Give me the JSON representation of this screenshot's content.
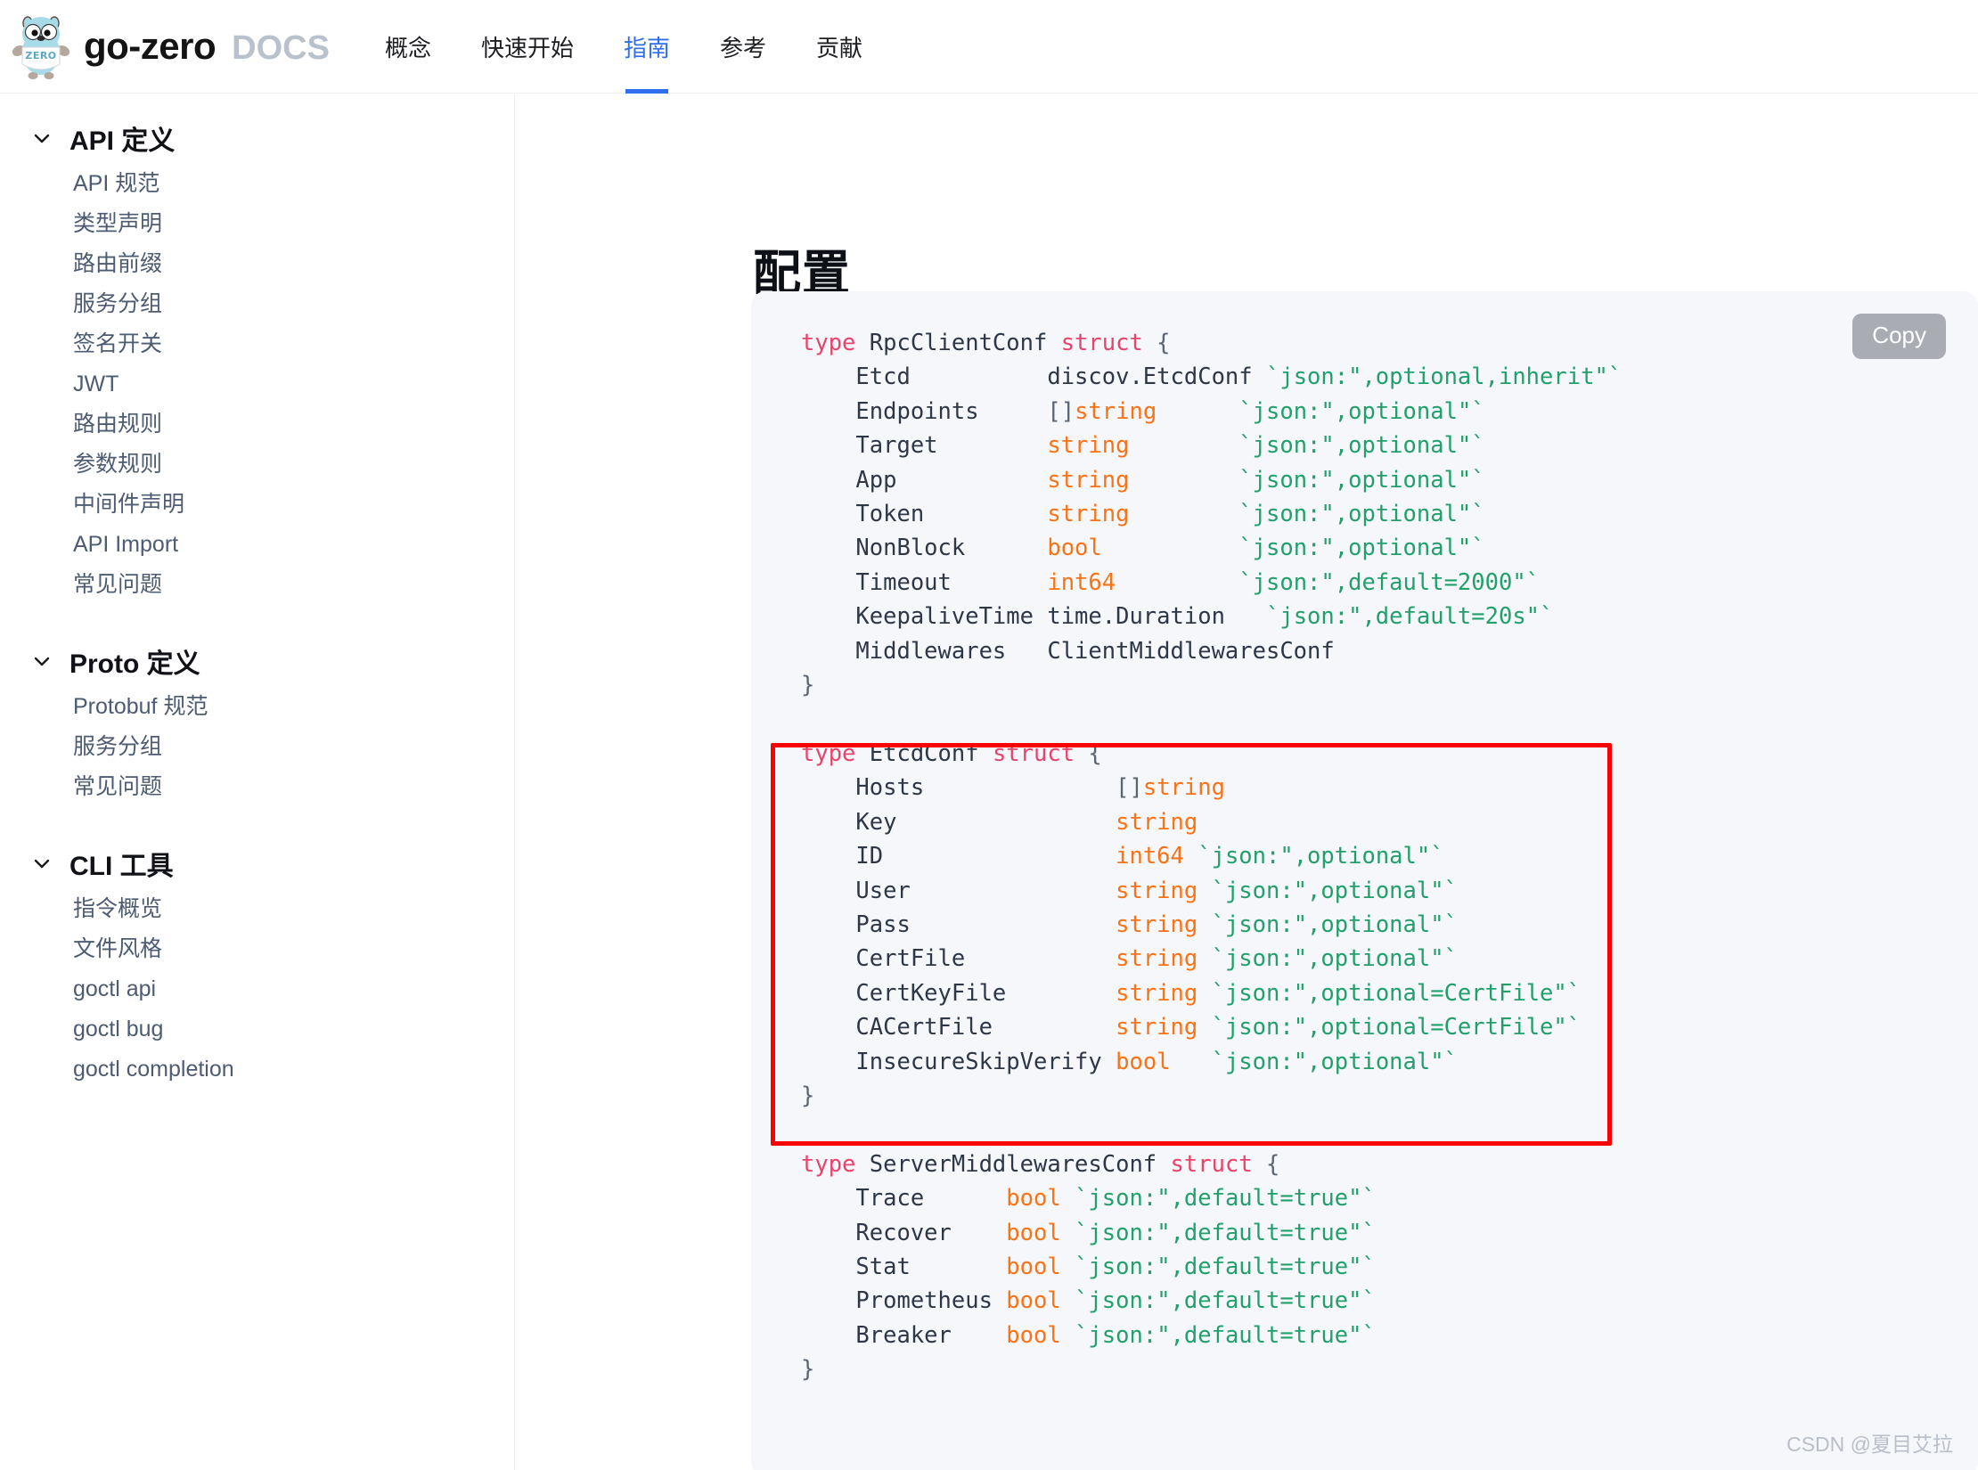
{
  "header": {
    "logo_icon": "go-gopher-zero-logo",
    "brand_name": "go-zero",
    "brand_docs": "DOCS",
    "nav": [
      {
        "label": "概念",
        "active": false
      },
      {
        "label": "快速开始",
        "active": false
      },
      {
        "label": "指南",
        "active": true
      },
      {
        "label": "参考",
        "active": false
      },
      {
        "label": "贡献",
        "active": false
      }
    ],
    "active_color": "#2f6fed"
  },
  "sidebar": {
    "sections": [
      {
        "title": "API 定义",
        "chevron_icon": "chevron-down-icon",
        "items": [
          "API 规范",
          "类型声明",
          "路由前缀",
          "服务分组",
          "签名开关",
          "JWT",
          "路由规则",
          "参数规则",
          "中间件声明",
          "API Import",
          "常见问题"
        ]
      },
      {
        "title": "Proto 定义",
        "chevron_icon": "chevron-down-icon",
        "items": [
          "Protobuf 规范",
          "服务分组",
          "常见问题"
        ]
      },
      {
        "title": "CLI 工具",
        "chevron_icon": "chevron-down-icon",
        "items": [
          "指令概览",
          "文件风格",
          "goctl api",
          "goctl bug",
          "goctl completion"
        ]
      }
    ]
  },
  "main": {
    "page_title": "配置",
    "copy_button": "Copy",
    "highlight_border_color": "#fa0000",
    "code_background": "#f6f7fb",
    "code_lines": [
      [
        {
          "t": "type ",
          "c": "key"
        },
        {
          "t": "RpcClientConf ",
          "c": "ident"
        },
        {
          "t": "struct",
          "c": "key"
        },
        {
          "t": " {",
          "c": "punc"
        }
      ],
      [
        {
          "t": "    Etcd          discov.EtcdConf ",
          "c": "ident"
        },
        {
          "t": "`json:\",optional,inherit\"`",
          "c": "tag"
        }
      ],
      [
        {
          "t": "    Endpoints     ",
          "c": "ident"
        },
        {
          "t": "[]",
          "c": "punc"
        },
        {
          "t": "string",
          "c": "type"
        },
        {
          "t": "      ",
          "c": "ident"
        },
        {
          "t": "`json:\",optional\"`",
          "c": "tag"
        }
      ],
      [
        {
          "t": "    Target        ",
          "c": "ident"
        },
        {
          "t": "string",
          "c": "type"
        },
        {
          "t": "        ",
          "c": "ident"
        },
        {
          "t": "`json:\",optional\"`",
          "c": "tag"
        }
      ],
      [
        {
          "t": "    App           ",
          "c": "ident"
        },
        {
          "t": "string",
          "c": "type"
        },
        {
          "t": "        ",
          "c": "ident"
        },
        {
          "t": "`json:\",optional\"`",
          "c": "tag"
        }
      ],
      [
        {
          "t": "    Token         ",
          "c": "ident"
        },
        {
          "t": "string",
          "c": "type"
        },
        {
          "t": "        ",
          "c": "ident"
        },
        {
          "t": "`json:\",optional\"`",
          "c": "tag"
        }
      ],
      [
        {
          "t": "    NonBlock      ",
          "c": "ident"
        },
        {
          "t": "bool",
          "c": "type"
        },
        {
          "t": "          ",
          "c": "ident"
        },
        {
          "t": "`json:\",optional\"`",
          "c": "tag"
        }
      ],
      [
        {
          "t": "    Timeout       ",
          "c": "ident"
        },
        {
          "t": "int64",
          "c": "type"
        },
        {
          "t": "         ",
          "c": "ident"
        },
        {
          "t": "`json:\",default=2000\"`",
          "c": "tag"
        }
      ],
      [
        {
          "t": "    KeepaliveTime time.Duration   ",
          "c": "ident"
        },
        {
          "t": "`json:\",default=20s\"`",
          "c": "tag"
        }
      ],
      [
        {
          "t": "    Middlewares   ClientMiddlewaresConf",
          "c": "ident"
        }
      ],
      [
        {
          "t": "}",
          "c": "punc"
        }
      ],
      [
        {
          "t": "",
          "c": "ident"
        }
      ],
      [
        {
          "t": "type ",
          "c": "key"
        },
        {
          "t": "EtcdConf ",
          "c": "ident"
        },
        {
          "t": "struct",
          "c": "key"
        },
        {
          "t": " {",
          "c": "punc"
        }
      ],
      [
        {
          "t": "    Hosts              ",
          "c": "ident"
        },
        {
          "t": "[]",
          "c": "punc"
        },
        {
          "t": "string",
          "c": "type"
        }
      ],
      [
        {
          "t": "    Key                ",
          "c": "ident"
        },
        {
          "t": "string",
          "c": "type"
        }
      ],
      [
        {
          "t": "    ID                 ",
          "c": "ident"
        },
        {
          "t": "int64",
          "c": "type"
        },
        {
          "t": " ",
          "c": "ident"
        },
        {
          "t": "`json:\",optional\"`",
          "c": "tag"
        }
      ],
      [
        {
          "t": "    User               ",
          "c": "ident"
        },
        {
          "t": "string",
          "c": "type"
        },
        {
          "t": " ",
          "c": "ident"
        },
        {
          "t": "`json:\",optional\"`",
          "c": "tag"
        }
      ],
      [
        {
          "t": "    Pass               ",
          "c": "ident"
        },
        {
          "t": "string",
          "c": "type"
        },
        {
          "t": " ",
          "c": "ident"
        },
        {
          "t": "`json:\",optional\"`",
          "c": "tag"
        }
      ],
      [
        {
          "t": "    CertFile           ",
          "c": "ident"
        },
        {
          "t": "string",
          "c": "type"
        },
        {
          "t": " ",
          "c": "ident"
        },
        {
          "t": "`json:\",optional\"`",
          "c": "tag"
        }
      ],
      [
        {
          "t": "    CertKeyFile        ",
          "c": "ident"
        },
        {
          "t": "string",
          "c": "type"
        },
        {
          "t": " ",
          "c": "ident"
        },
        {
          "t": "`json:\",optional=CertFile\"`",
          "c": "tag"
        }
      ],
      [
        {
          "t": "    CACertFile         ",
          "c": "ident"
        },
        {
          "t": "string",
          "c": "type"
        },
        {
          "t": " ",
          "c": "ident"
        },
        {
          "t": "`json:\",optional=CertFile\"`",
          "c": "tag"
        }
      ],
      [
        {
          "t": "    InsecureSkipVerify ",
          "c": "ident"
        },
        {
          "t": "bool",
          "c": "type"
        },
        {
          "t": "   ",
          "c": "ident"
        },
        {
          "t": "`json:\",optional\"`",
          "c": "tag"
        }
      ],
      [
        {
          "t": "}",
          "c": "punc"
        }
      ],
      [
        {
          "t": "",
          "c": "ident"
        }
      ],
      [
        {
          "t": "type ",
          "c": "key"
        },
        {
          "t": "ServerMiddlewaresConf ",
          "c": "ident"
        },
        {
          "t": "struct",
          "c": "key"
        },
        {
          "t": " {",
          "c": "punc"
        }
      ],
      [
        {
          "t": "    Trace      ",
          "c": "ident"
        },
        {
          "t": "bool",
          "c": "type"
        },
        {
          "t": " ",
          "c": "ident"
        },
        {
          "t": "`json:\",default=true\"`",
          "c": "tag"
        }
      ],
      [
        {
          "t": "    Recover    ",
          "c": "ident"
        },
        {
          "t": "bool",
          "c": "type"
        },
        {
          "t": " ",
          "c": "ident"
        },
        {
          "t": "`json:\",default=true\"`",
          "c": "tag"
        }
      ],
      [
        {
          "t": "    Stat       ",
          "c": "ident"
        },
        {
          "t": "bool",
          "c": "type"
        },
        {
          "t": " ",
          "c": "ident"
        },
        {
          "t": "`json:\",default=true\"`",
          "c": "tag"
        }
      ],
      [
        {
          "t": "    Prometheus ",
          "c": "ident"
        },
        {
          "t": "bool",
          "c": "type"
        },
        {
          "t": " ",
          "c": "ident"
        },
        {
          "t": "`json:\",default=true\"`",
          "c": "tag"
        }
      ],
      [
        {
          "t": "    Breaker    ",
          "c": "ident"
        },
        {
          "t": "bool",
          "c": "type"
        },
        {
          "t": " ",
          "c": "ident"
        },
        {
          "t": "`json:\",default=true\"`",
          "c": "tag"
        }
      ],
      [
        {
          "t": "}",
          "c": "punc"
        }
      ]
    ],
    "watermark": "CSDN @夏目艾拉"
  }
}
